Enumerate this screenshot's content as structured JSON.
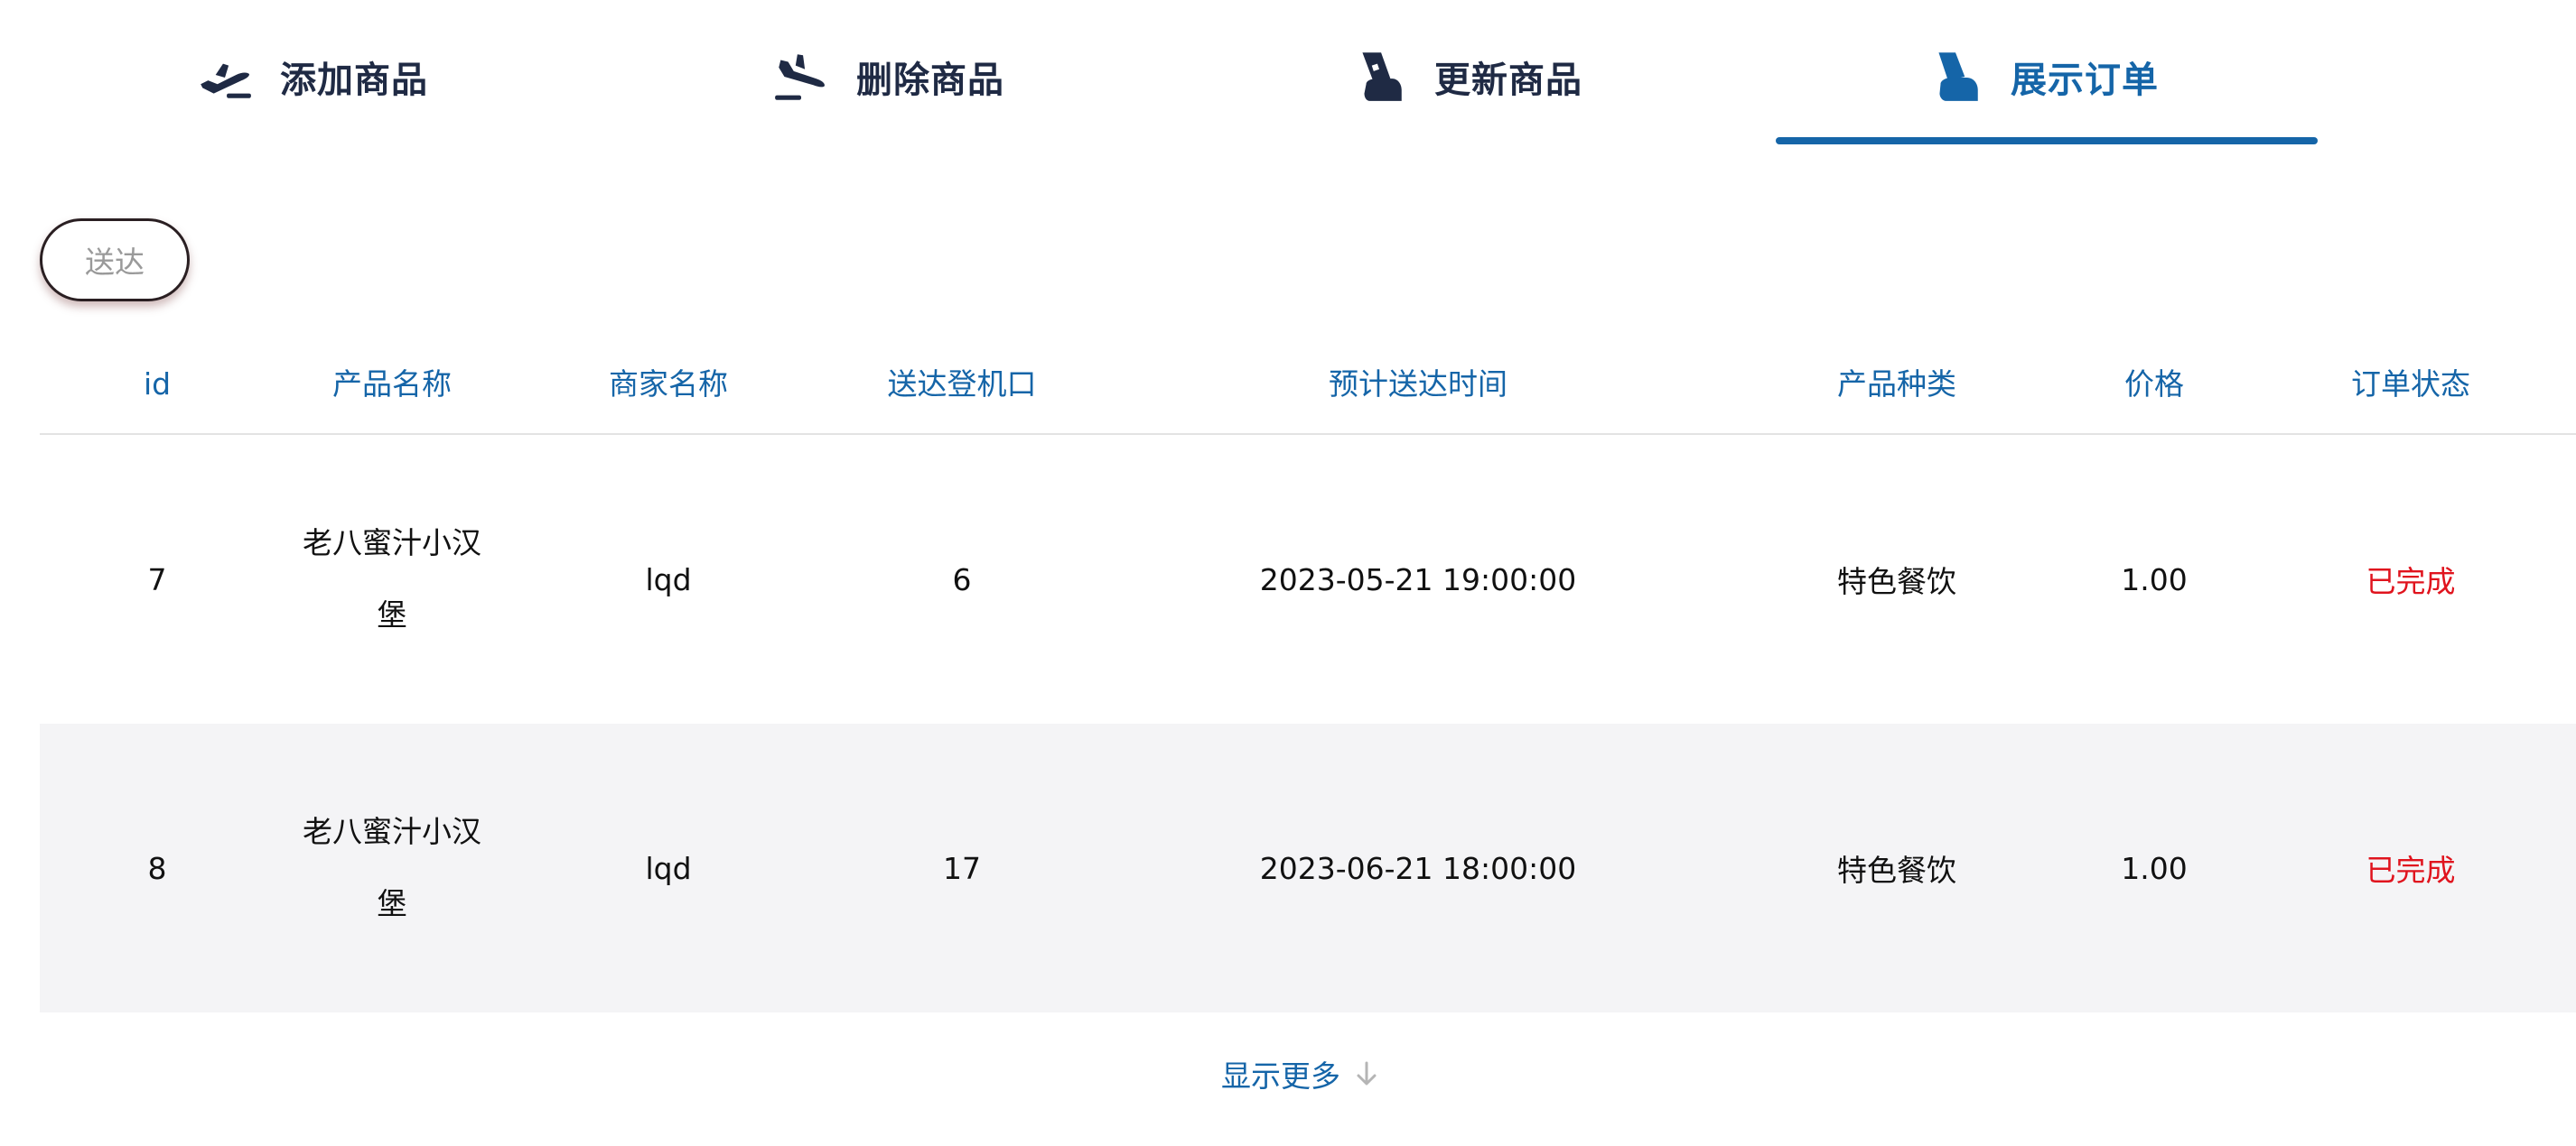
{
  "tabs": [
    {
      "label": "添加商品",
      "icon": "airplane-takeoff-icon"
    },
    {
      "label": "删除商品",
      "icon": "airplane-landing-icon"
    },
    {
      "label": "更新商品",
      "icon": "boarding-pass-icon"
    },
    {
      "label": "展示订单",
      "icon": "boarding-pass-hand-icon",
      "active": true
    }
  ],
  "toolbar": {
    "deliver_label": "送达"
  },
  "table": {
    "headers": [
      "id",
      "产品名称",
      "商家名称",
      "送达登机口",
      "预计送达时间",
      "产品种类",
      "价格",
      "订单状态"
    ],
    "rows": [
      {
        "id": "7",
        "product": "老八蜜汁小汉堡",
        "merchant": "lqd",
        "gate": "6",
        "eta": "2023-05-21 19:00:00",
        "category": "特色餐饮",
        "price": "1.00",
        "status": "已完成"
      },
      {
        "id": "8",
        "product": "老八蜜汁小汉堡",
        "merchant": "lqd",
        "gate": "17",
        "eta": "2023-06-21 18:00:00",
        "category": "特色餐饮",
        "price": "1.00",
        "status": "已完成"
      }
    ]
  },
  "footer": {
    "show_more": "显示更多",
    "show_more_icon": "arrow-down-icon"
  },
  "colors": {
    "accent": "#1565a8",
    "status_done": "#e0141e",
    "tab_text": "#1f2a44",
    "row_alt_bg": "#f4f4f6"
  }
}
